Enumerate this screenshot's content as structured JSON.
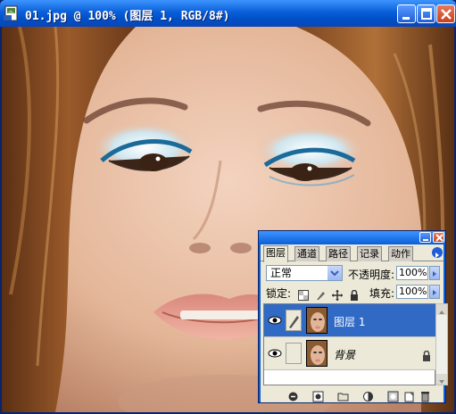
{
  "window": {
    "title": "01.jpg @ 100% (图层 1, RGB/8#)",
    "icon": "photoshop-document-icon",
    "controls": [
      "minimize-icon",
      "maximize-icon",
      "close-icon"
    ]
  },
  "layers_palette": {
    "tabs": [
      "图层",
      "通道",
      "路径",
      "记录",
      "动作"
    ],
    "active_tab": "图层",
    "blend_mode": "正常",
    "opacity_label": "不透明度:",
    "opacity_value": "100%",
    "lock_label": "锁定:",
    "fill_label": "填充:",
    "fill_value": "100%",
    "layers": [
      {
        "name": "图层 1",
        "selected": true,
        "visible": true
      },
      {
        "name": "背景",
        "selected": false,
        "visible": true,
        "locked": true
      }
    ],
    "footer_icons": [
      "link-layers-icon",
      "add-layer-style-icon",
      "add-mask-icon",
      "new-group-icon",
      "new-adjustment-layer-icon",
      "new-layer-icon",
      "delete-layer-icon"
    ]
  },
  "colors": {
    "titlebar": "#0a5fd8",
    "selected_layer": "#316ac5",
    "panel_bg": "#ece9d8"
  }
}
